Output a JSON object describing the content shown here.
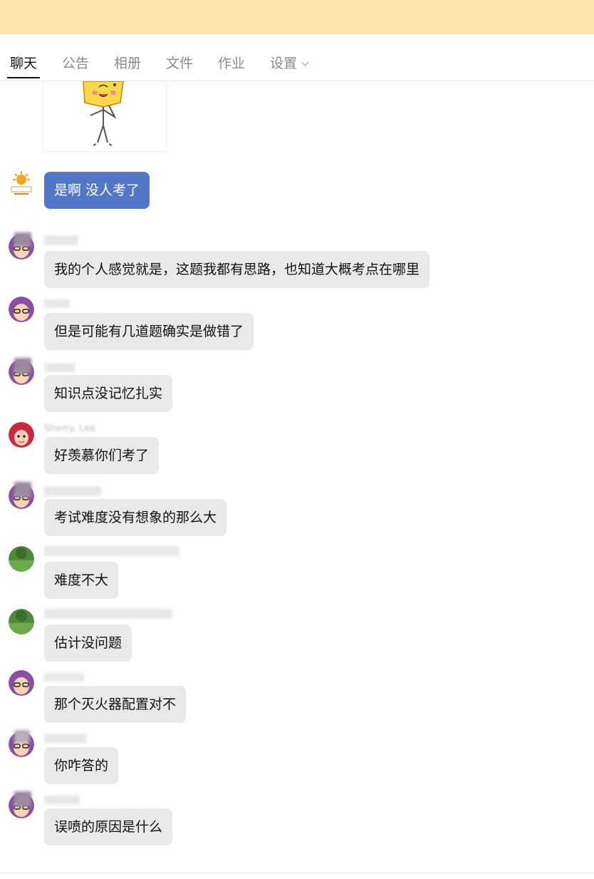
{
  "tabs": [
    {
      "label": "聊天",
      "active": true
    },
    {
      "label": "公告"
    },
    {
      "label": "相册"
    },
    {
      "label": "文件"
    },
    {
      "label": "作业"
    },
    {
      "label": "设置"
    }
  ],
  "messages": [
    {
      "name": "",
      "text": "是啊  没人考了"
    },
    {
      "name": "",
      "text": "我的个人感觉就是，这题我都有思路，也知道大概考点在哪里"
    },
    {
      "name": "",
      "text": "但是可能有几道题确实是做错了"
    },
    {
      "name": "",
      "text": "知识点没记忆扎实"
    },
    {
      "name": "Sherry. Lee",
      "text": "好羡慕你们考了"
    },
    {
      "name": "",
      "text": "考试难度没有想象的那么大"
    },
    {
      "name": "",
      "text": "难度不大"
    },
    {
      "name": "",
      "text": "估计没问题"
    },
    {
      "name": "",
      "text": "那个灭火器配置对不"
    },
    {
      "name": "",
      "text": "你咋答的"
    },
    {
      "name": "",
      "text": "误喷的原因是什么"
    }
  ],
  "colors": {
    "banner": "#fbe4ad",
    "accent_bubble": "#5277c9",
    "bubble": "#e9e9e9"
  }
}
